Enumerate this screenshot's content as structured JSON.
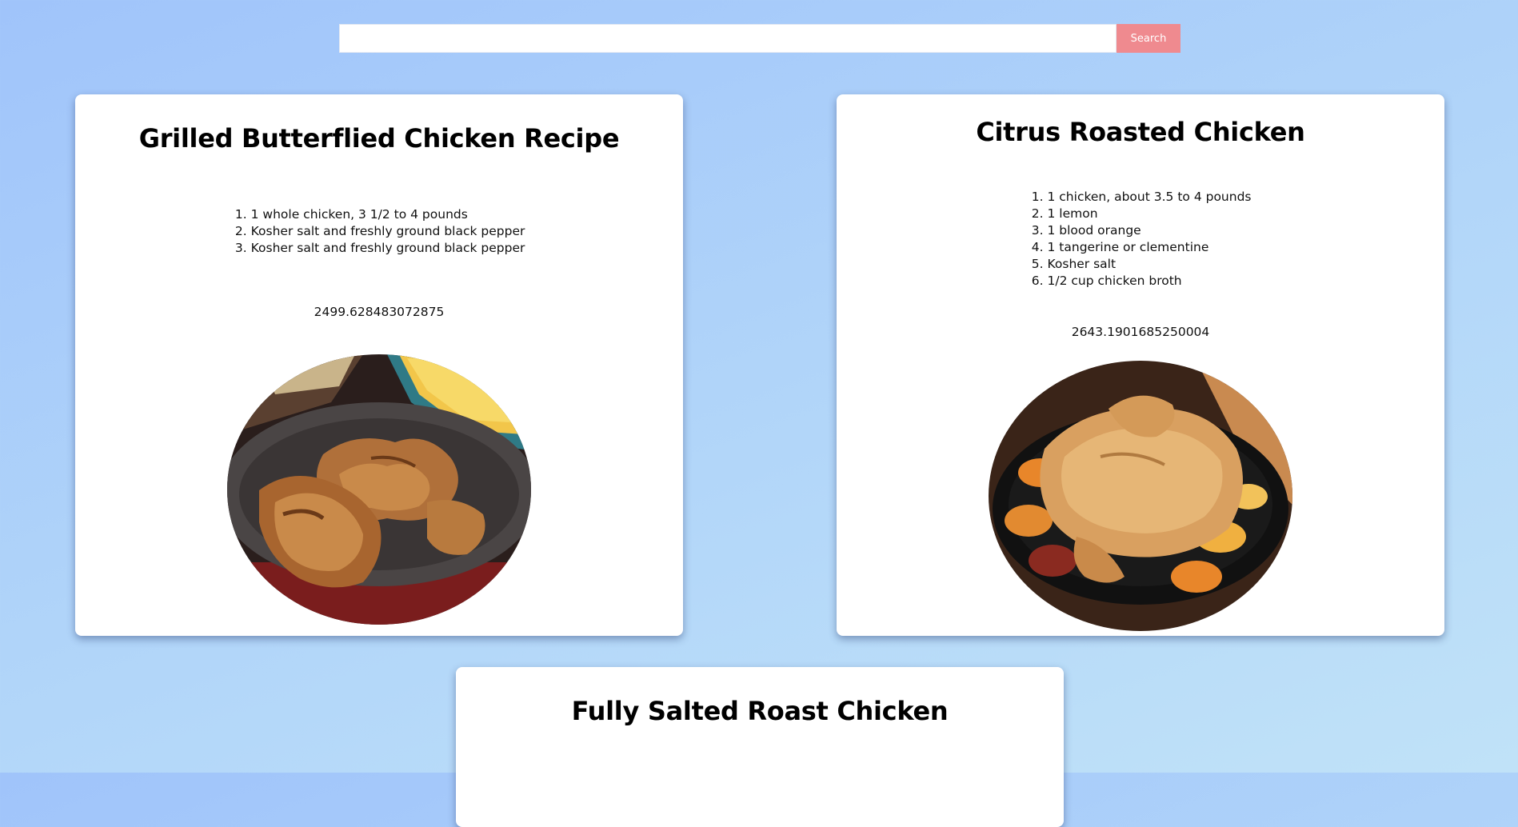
{
  "search": {
    "placeholder": "",
    "value": "",
    "button_label": "Search"
  },
  "recipes": [
    {
      "title": "Grilled Butterflied Chicken Recipe",
      "ingredients": [
        "1 whole chicken, 3 1/2 to 4 pounds",
        "Kosher salt and freshly ground black pepper",
        "Kosher salt and freshly ground black pepper"
      ],
      "score": "2499.628483072875"
    },
    {
      "title": "Citrus Roasted Chicken",
      "ingredients": [
        "1 chicken, about 3.5 to 4 pounds",
        "1 lemon",
        "1 blood orange",
        "1 tangerine or clementine",
        "Kosher salt",
        "1/2 cup chicken broth"
      ],
      "score": "2643.1901685250004"
    },
    {
      "title": "Fully Salted Roast Chicken"
    }
  ],
  "colors": {
    "search_button": "#ef8a8f",
    "card_background": "#ffffff"
  }
}
